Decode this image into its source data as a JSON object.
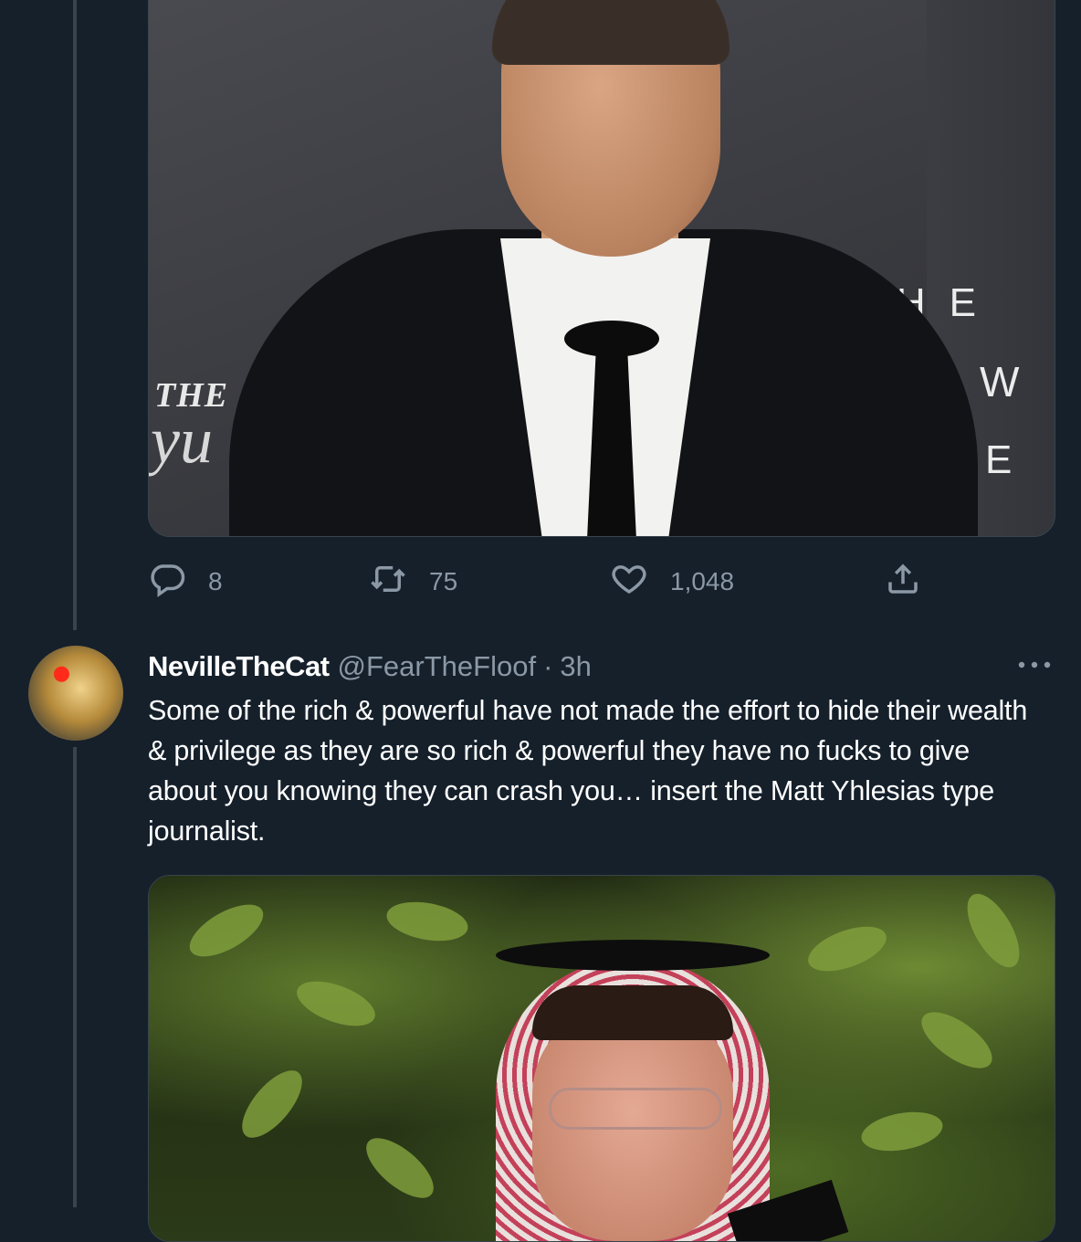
{
  "tweet1": {
    "stats": {
      "replies": "8",
      "retweets": "75",
      "likes": "1,048"
    },
    "photo_text": {
      "left_the": "THE",
      "left_script": "yu",
      "right_the": "THE",
      "right_w": "W",
      "right_e": "E"
    }
  },
  "tweet2": {
    "display_name": "NevilleTheCat",
    "handle": "@FearTheFloof",
    "separator": "·",
    "time": "3h",
    "text": "Some of the rich & powerful have not made the effort to hide their wealth & privilege as they are so rich & powerful they have no fucks to give about you knowing they can crash you… insert the Matt Yhlesias type journalist."
  },
  "colors": {
    "background": "#15202b",
    "secondary_text": "#8b98a5",
    "border": "#38444d"
  },
  "icons": [
    "reply-icon",
    "retweet-icon",
    "like-icon",
    "share-icon",
    "more-options-icon"
  ]
}
